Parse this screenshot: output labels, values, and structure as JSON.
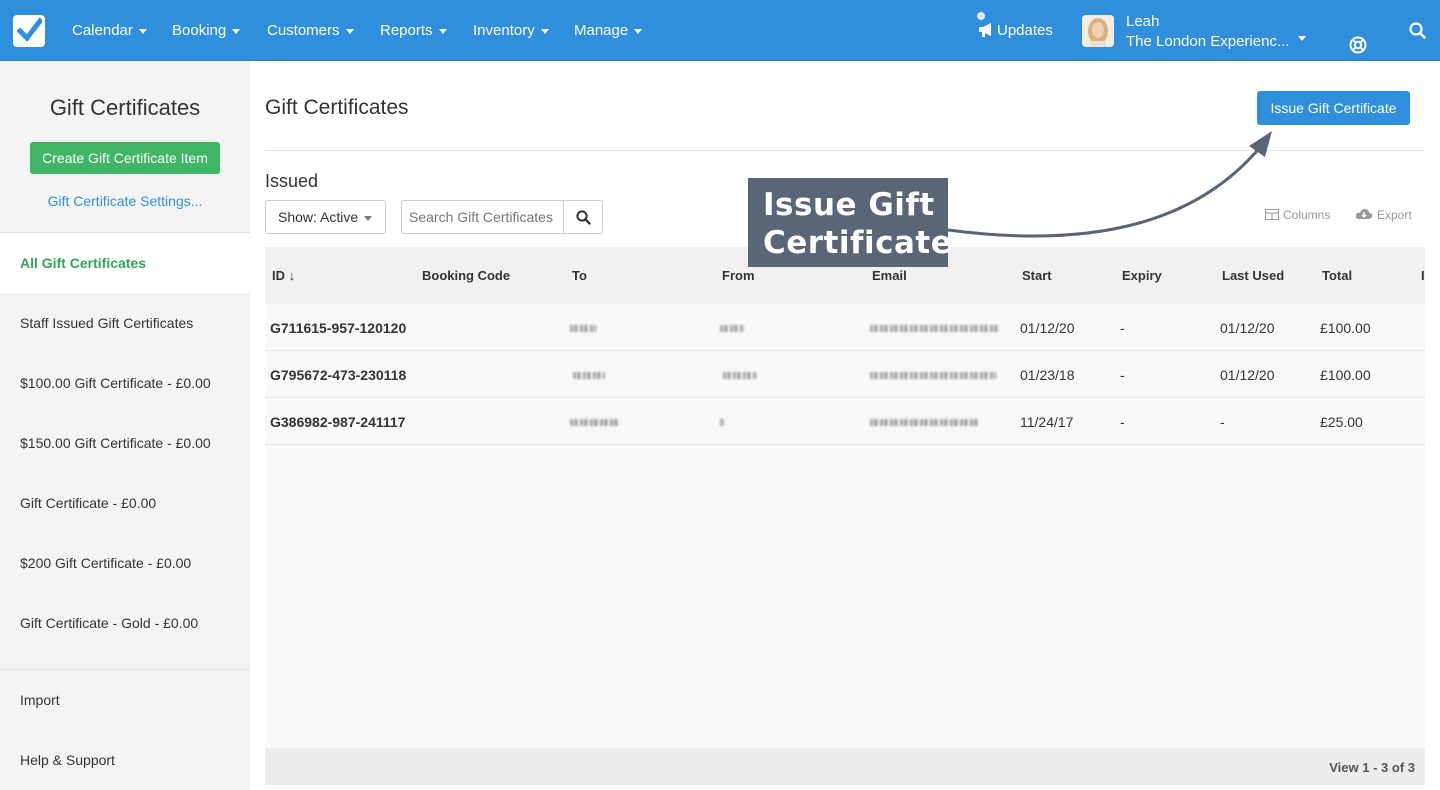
{
  "nav": {
    "items": [
      "Calendar",
      "Booking",
      "Customers",
      "Reports",
      "Inventory",
      "Manage"
    ],
    "updates": "Updates",
    "user_name": "Leah",
    "user_company": "The London Experienc..."
  },
  "sidebar": {
    "title": "Gift Certificates",
    "create_button": "Create Gift Certificate Item",
    "settings_link": "Gift Certificate Settings...",
    "items": [
      "All Gift Certificates",
      "Staff Issued Gift Certificates",
      "$100.00 Gift Certificate - £0.00",
      "$150.00 Gift Certificate - £0.00",
      "Gift Certificate - £0.00",
      "$200 Gift Certificate - £0.00",
      "Gift Certificate - Gold - £0.00"
    ],
    "bottom_items": [
      "Import",
      "Help & Support"
    ]
  },
  "main": {
    "title": "Gift Certificates",
    "issue_button": "Issue Gift Certificate",
    "section_label": "Issued",
    "show_select": "Show: Active",
    "search_placeholder": "Search Gift Certificates",
    "columns_link": "Columns",
    "export_link": "Export"
  },
  "table": {
    "headers": [
      "ID ↓",
      "Booking Code",
      "To",
      "From",
      "Email",
      "Start",
      "Expiry",
      "Last Used",
      "Total"
    ],
    "rows": [
      {
        "id": "G711615-957-120120",
        "start": "01/12/20",
        "expiry": "-",
        "last_used": "01/12/20",
        "total": "£100.00"
      },
      {
        "id": "G795672-473-230118",
        "start": "01/23/18",
        "expiry": "-",
        "last_used": "01/12/20",
        "total": "£100.00"
      },
      {
        "id": "G386982-987-241117",
        "start": "11/24/17",
        "expiry": "-",
        "last_used": "-",
        "total": "£25.00"
      }
    ],
    "footer": "View 1 - 3 of 3"
  },
  "callout": {
    "line1": "Issue Gift",
    "line2": "Certificate"
  },
  "colors": {
    "brand_blue": "#2f8fdc",
    "create_green": "#3fb565",
    "active_green": "#2fa65a",
    "callout_bg": "#5a6576"
  }
}
